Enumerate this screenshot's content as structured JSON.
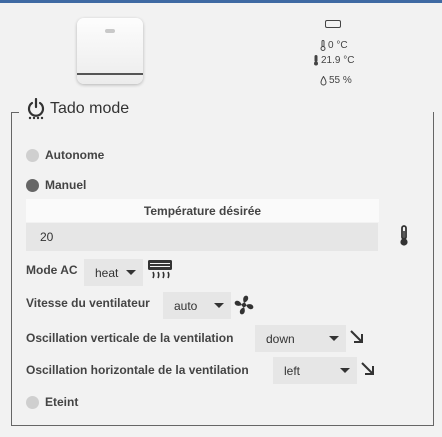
{
  "status": {
    "setpoint": "0 °C",
    "temperature": "21.9 °C",
    "humidity": "55 %"
  },
  "mode": {
    "title": "Tado mode",
    "options": {
      "autonome": "Autonome",
      "manuel": "Manuel",
      "eteint": "Eteint"
    },
    "selected": "Manuel"
  },
  "manual": {
    "temp_label": "Température désirée",
    "temp_value": "20",
    "mode_ac_label": "Mode AC",
    "mode_ac_value": "heat",
    "fan_label": "Vitesse du ventilateur",
    "fan_value": "auto",
    "swing_v_label": "Oscillation verticale de la ventilation",
    "swing_v_value": "down",
    "swing_h_label": "Oscillation horizontale de la ventilation",
    "swing_h_value": "left"
  },
  "icons": {
    "power": "power-icon",
    "thermometer": "thermometer-icon",
    "drop": "water-drop-icon",
    "battery": "battery-icon",
    "ac": "air-conditioner-icon",
    "fan": "fan-icon",
    "arrow": "arrow-down-right-icon"
  },
  "colors": {
    "accent_bar": "#3f6aa3",
    "radio_selected": "#666666",
    "radio_unselected": "#cfcfcf"
  }
}
